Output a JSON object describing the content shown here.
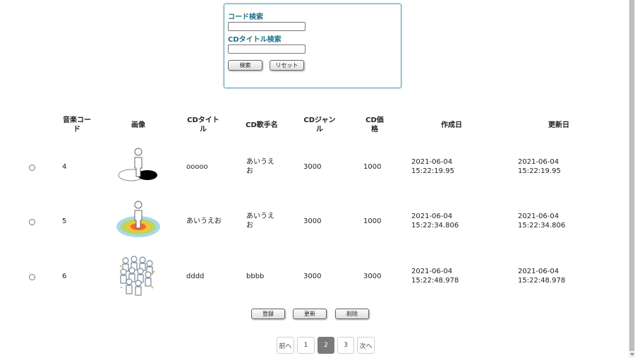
{
  "search": {
    "code_label": "コード検索",
    "code_value": "",
    "title_label": "CDタイトル検索",
    "title_value": "",
    "search_button": "検索",
    "reset_button": "リセット"
  },
  "table": {
    "headers": [
      "音楽コード",
      "画像",
      "CDタイトル",
      "CD歌手名",
      "CDジャンル",
      "CD価格",
      "作成日",
      "更新日"
    ],
    "rows": [
      {
        "code": "4",
        "image": "person-shadow-icon",
        "title": "ooooo",
        "singer": "あいうえお",
        "genre": "3000",
        "price": "1000",
        "created": "2021-06-04 15:22:19.95",
        "updated": "2021-06-04 15:22:19.95"
      },
      {
        "code": "5",
        "image": "person-target-icon",
        "title": "あいうえお",
        "singer": "あいうえお",
        "genre": "3000",
        "price": "1000",
        "created": "2021-06-04 15:22:34.806",
        "updated": "2021-06-04 15:22:34.806"
      },
      {
        "code": "6",
        "image": "crowd-icon",
        "title": "dddd",
        "singer": "bbbb",
        "genre": "3000",
        "price": "3000",
        "created": "2021-06-04 15:22:48.978",
        "updated": "2021-06-04 15:22:48.978"
      }
    ]
  },
  "actions": {
    "register": "登録",
    "update": "更新",
    "delete": "削除"
  },
  "pagination": {
    "prev": "前へ",
    "pages": [
      "1",
      "2",
      "3"
    ],
    "current": "2",
    "next": "次へ"
  }
}
